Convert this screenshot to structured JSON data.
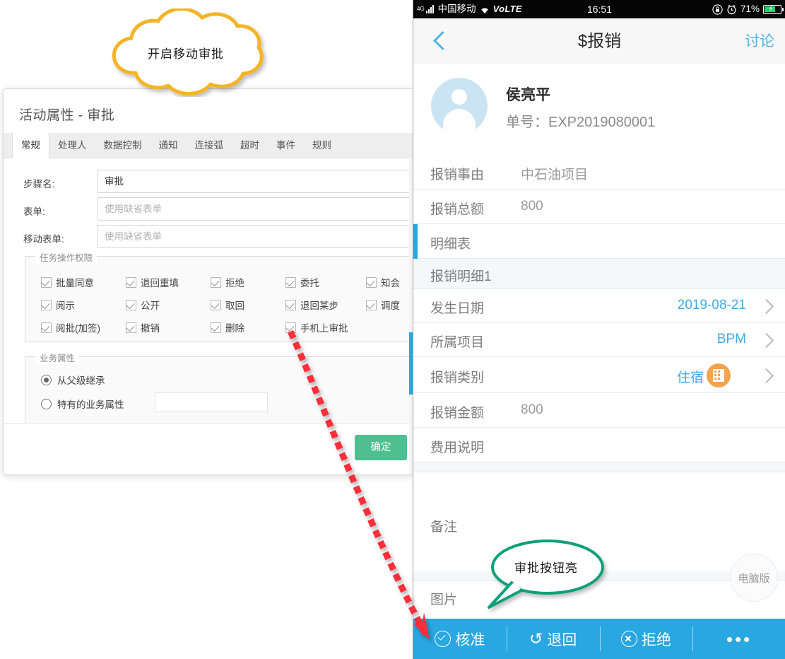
{
  "annotations": {
    "cloud_text": "开启移动审批",
    "green_bubble_text": "审批按钮亮",
    "cloud_border_color": "#f5b325",
    "green_border_color": "#11a07a",
    "arrow_color": "#fb2d3a"
  },
  "dialog": {
    "title": "活动属性 - 审批",
    "tabs": [
      {
        "label": "常规",
        "active": true
      },
      {
        "label": "处理人",
        "active": false
      },
      {
        "label": "数据控制",
        "active": false
      },
      {
        "label": "通知",
        "active": false
      },
      {
        "label": "连接弧",
        "active": false
      },
      {
        "label": "超时",
        "active": false
      },
      {
        "label": "事件",
        "active": false
      },
      {
        "label": "规则",
        "active": false
      }
    ],
    "fields": [
      {
        "label": "步骤名:",
        "value": "审批",
        "placeholder": "",
        "is_placeholder": false
      },
      {
        "label": "表单:",
        "value": "使用缺省表单",
        "placeholder": "使用缺省表单",
        "is_placeholder": true
      },
      {
        "label": "移动表单:",
        "value": "使用缺省表单",
        "placeholder": "使用缺省表单",
        "is_placeholder": true
      }
    ],
    "permissions": {
      "legend": "任务操作权限",
      "items": [
        {
          "label": "批量同意",
          "checked": true
        },
        {
          "label": "退回重填",
          "checked": true
        },
        {
          "label": "拒绝",
          "checked": true
        },
        {
          "label": "委托",
          "checked": true
        },
        {
          "label": "知会",
          "checked": true
        },
        {
          "label": "阅示",
          "checked": true
        },
        {
          "label": "公开",
          "checked": true
        },
        {
          "label": "取回",
          "checked": true
        },
        {
          "label": "退回某步",
          "checked": true
        },
        {
          "label": "调度",
          "checked": true
        },
        {
          "label": "阅批(加签)",
          "checked": true
        },
        {
          "label": "撤销",
          "checked": true
        },
        {
          "label": "删除",
          "checked": true
        },
        {
          "label": "手机上审批",
          "checked": true
        }
      ]
    },
    "business": {
      "legend": "业务属性",
      "options": [
        {
          "label": "从父级继承",
          "selected": true
        },
        {
          "label": "特有的业务属性",
          "selected": false
        }
      ],
      "input_value": ""
    },
    "footer": {
      "ok_label": "确定"
    }
  },
  "phone": {
    "status_bar": {
      "network_type": "4G",
      "carrier": "中国移动",
      "volte": "VoLTE",
      "time": "16:51",
      "battery_percent": "71%",
      "icons": [
        "signal-icon",
        "wifi-icon",
        "lock-rotation-icon",
        "alarm-icon",
        "battery-charging-icon"
      ]
    },
    "nav": {
      "back_icon": "chevron-left-icon",
      "title": "$报销",
      "action_label": "讨论"
    },
    "user": {
      "name": "侯亮平",
      "order_no": "单号：EXP2019080001"
    },
    "rows": [
      {
        "label": "报销事由",
        "value": "中石油项目",
        "style": "plain"
      },
      {
        "label": "报销总额",
        "value": "800",
        "style": "plain"
      },
      {
        "label": "明细表",
        "value": "",
        "style": "section"
      },
      {
        "label": "报销明细1",
        "value": "",
        "style": "subheader"
      },
      {
        "label": "发生日期",
        "value": "2019-08-21",
        "style": "link-chevron"
      },
      {
        "label": "所属项目",
        "value": "BPM",
        "style": "link-chevron"
      },
      {
        "label": "报销类别",
        "value": "住宿",
        "style": "link-chevron-icon"
      },
      {
        "label": "报销金额",
        "value": "800",
        "style": "plain"
      },
      {
        "label": "费用说明",
        "value": "",
        "style": "plain"
      },
      {
        "label": "备注",
        "value": "",
        "style": "tall"
      },
      {
        "label": "图片",
        "value": "",
        "style": "plain"
      }
    ],
    "fab_label": "电脑版",
    "bottom_bar": [
      {
        "label": "核准",
        "icon": "check-circle-icon"
      },
      {
        "label": "退回",
        "icon": "undo-icon"
      },
      {
        "label": "拒绝",
        "icon": "x-circle-icon"
      },
      {
        "label": "",
        "icon": "more-dots-icon"
      }
    ],
    "accent_color": "#29a7e1"
  }
}
